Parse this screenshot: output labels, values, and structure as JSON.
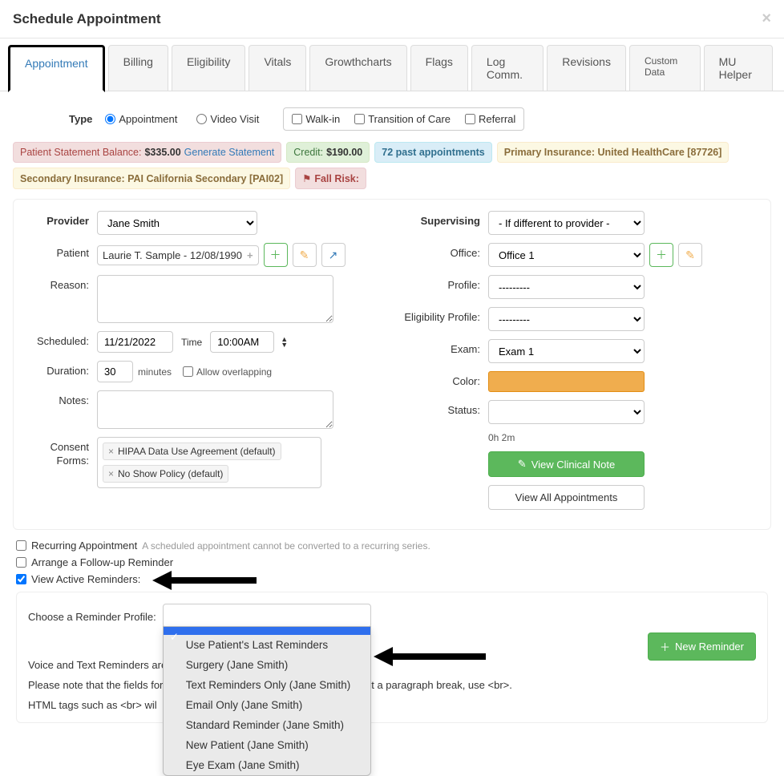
{
  "header": {
    "title": "Schedule Appointment"
  },
  "tabs": [
    "Appointment",
    "Billing",
    "Eligibility",
    "Vitals",
    "Growthcharts",
    "Flags",
    "Log Comm.",
    "Revisions",
    "Custom Data",
    "MU Helper"
  ],
  "type": {
    "label": "Type",
    "radios": [
      "Appointment",
      "Video Visit"
    ],
    "checks": [
      "Walk-in",
      "Transition of Care",
      "Referral"
    ]
  },
  "badges": {
    "statement_label": "Patient Statement Balance:",
    "statement_amount": "$335.00",
    "generate": "Generate Statement",
    "credit_label": "Credit:",
    "credit_amount": "$190.00",
    "past": "72 past appointments",
    "primary": "Primary Insurance: United HealthCare [87726]",
    "secondary": "Secondary Insurance: PAI California Secondary [PAI02]",
    "fallrisk": "Fall Risk:"
  },
  "left": {
    "provider_label": "Provider",
    "provider_value": "Jane Smith",
    "patient_label": "Patient",
    "patient_value": "Laurie T. Sample - 12/08/1990",
    "reason_label": "Reason:",
    "scheduled_label": "Scheduled:",
    "scheduled_date": "11/21/2022",
    "time_label": "Time",
    "scheduled_time": "10:00AM",
    "duration_label": "Duration:",
    "duration_value": "30",
    "minutes": "minutes",
    "allow_overlap": "Allow overlapping",
    "notes_label": "Notes:",
    "consent_label": "Consent Forms:",
    "consent1": "HIPAA Data Use Agreement (default)",
    "consent2": "No Show Policy (default)"
  },
  "right": {
    "supervising_label": "Supervising",
    "supervising_value": "- If different to provider -",
    "office_label": "Office:",
    "office_value": "Office 1",
    "profile_label": "Profile:",
    "profile_value": "---------",
    "elig_label": "Eligibility Profile:",
    "elig_value": "---------",
    "exam_label": "Exam:",
    "exam_value": "Exam 1",
    "color_label": "Color:",
    "status_label": "Status:",
    "status_time": "0h 2m",
    "view_note": "View Clinical Note",
    "view_all": "View All Appointments"
  },
  "below": {
    "recurring": "Recurring Appointment",
    "recurring_hint": "A scheduled appointment cannot be converted to a recurring series.",
    "followup": "Arrange a Follow-up Reminder",
    "view_active": "View Active Reminders:"
  },
  "reminder": {
    "choose_label": "Choose a Reminder Profile:",
    "options": [
      "",
      "Use Patient's Last Reminders",
      "Surgery (Jane Smith)",
      "Text Reminders Only (Jane Smith)",
      "Email Only (Jane Smith)",
      "Standard Reminder (Jane Smith)",
      "New Patient (Jane Smith)",
      "Eye Exam (Jane Smith)"
    ],
    "new_btn": "New Reminder",
    "note1_prefix": "Voice and Text Reminders are",
    "note2_prefix": "Please note that the fields for",
    "note2_suffix": ", to insert a paragraph break, use <br>.",
    "note3_prefix": "HTML tags such as <br> wil"
  }
}
